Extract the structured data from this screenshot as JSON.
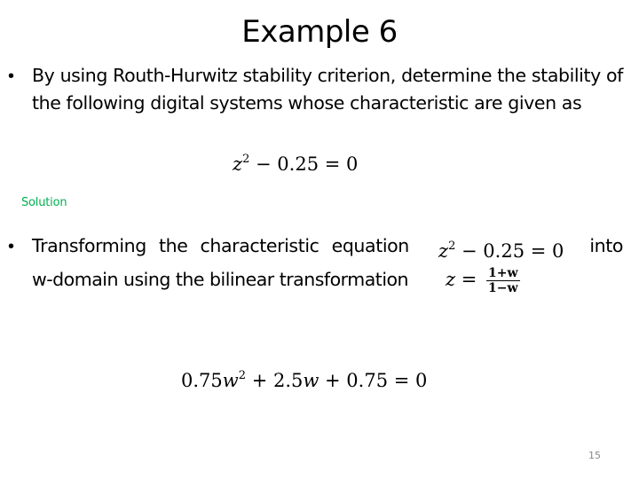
{
  "slide": {
    "title": "Example 6",
    "page_number": "15",
    "colors": {
      "text": "#000000",
      "solution_label": "#00b050",
      "page_number": "#898989",
      "background": "#ffffff"
    }
  },
  "bullets": [
    {
      "marker": "•",
      "text": "By using Routh-Hurwitz stability criterion, determine the stability of the following digital systems whose characteristic are given as"
    },
    {
      "marker": "•",
      "text_before": "Transforming the characteristic equation",
      "inline_equation": {
        "base": "z",
        "exponent": "2",
        "rest": " − 0.25 = 0"
      },
      "text_after": "into",
      "line2_text": "w-domain using the bilinear transformation",
      "transform": {
        "lhs": "z",
        "equals": " = ",
        "numerator": "1+w",
        "denominator": "1−w"
      }
    }
  ],
  "equation1": {
    "base": "z",
    "exponent": "2",
    "rest": " − 0.25 = 0"
  },
  "solution_label": "Solution",
  "equation2": {
    "coef": "0.75",
    "var": "w",
    "exponent": "2",
    "rest_a": " + 2.5",
    "var2": "w",
    "rest_b": " + 0.75 = 0"
  }
}
